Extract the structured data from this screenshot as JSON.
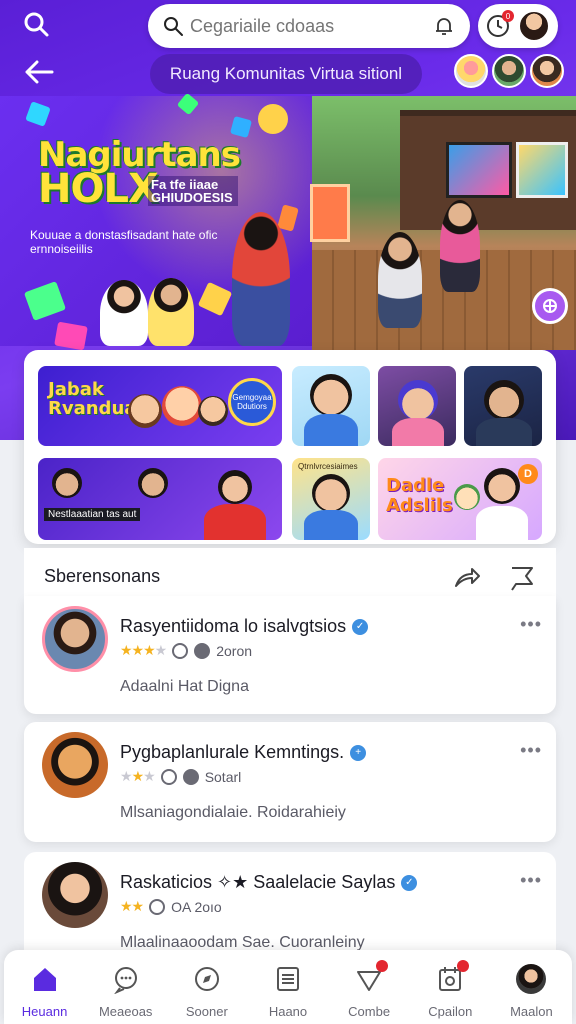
{
  "header": {
    "search_placeholder": "Cegariaile cdoaas",
    "community_title": "Ruang Komunitas Virtua sitionl",
    "notification_count": "0"
  },
  "banner": {
    "title_line1": "Nagiurtans",
    "title_line2": "HOLX",
    "subtitle": "Fa tfe iiaae GHIUDOESIS",
    "caption": "Kouuae a donstasfisadant hate ofic ernnoiseiilis"
  },
  "gallery": {
    "tile1_title": "Jabak Rvanduan",
    "tile1_badge": "Gemgoyaa Ddutiors",
    "tile5_text": "Nestlaaatian tas aut",
    "tile6_text": "Qtrnlvrcesiaimes",
    "tile7_title": "Dadle Adslils",
    "tile7_badge": "D"
  },
  "section": {
    "title": "Sberensonans"
  },
  "list": [
    {
      "name": "Rasyentiidoma lo isalvgtsios",
      "meta": "2oron",
      "description": "Adaalni Hat Digna",
      "rating": 4
    },
    {
      "name": "Pygbaplanlurale Kemntings.",
      "meta": "Sotarl",
      "description": "Mlsaniagondialaie. Roidarahieiy",
      "rating": 3
    },
    {
      "name": "Raskaticios ✧★ Saalelacie Saylas",
      "meta": "OA 2oıo",
      "description": "Mlaalinaaoodam Sae. Cuoranleiny",
      "rating": 2
    }
  ],
  "nav": [
    {
      "label": "Heuann",
      "icon": "home-icon",
      "active": true
    },
    {
      "label": "Meaeoas",
      "icon": "chat-icon"
    },
    {
      "label": "Sooner",
      "icon": "compass-icon"
    },
    {
      "label": "Haano",
      "icon": "list-icon"
    },
    {
      "label": "Combe",
      "icon": "heart-icon",
      "badge": true
    },
    {
      "label": "Cpailon",
      "icon": "calendar-icon",
      "badge": true
    },
    {
      "label": "Maalon",
      "icon": "profile-icon"
    }
  ],
  "colors": {
    "accent": "#5a2be0",
    "hero_purple": "#6a2bea",
    "verified_blue": "#3d8fe0",
    "star_gold": "#f5b320",
    "badge_red": "#e3262f"
  }
}
